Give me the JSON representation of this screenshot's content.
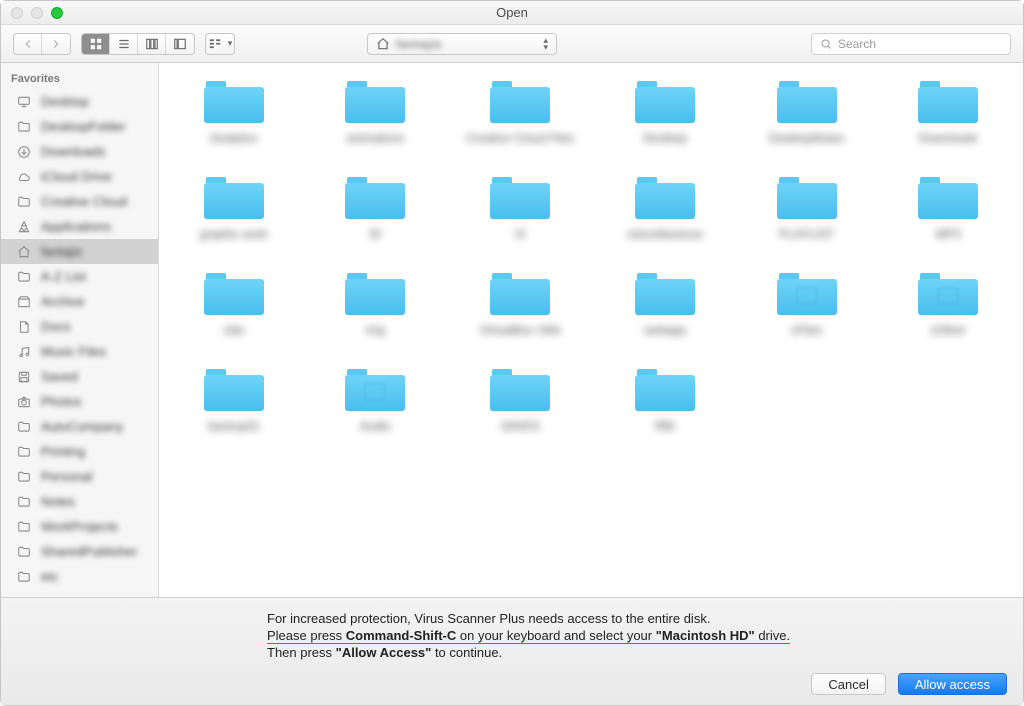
{
  "window": {
    "title": "Open"
  },
  "toolbar": {
    "path_label": "fantajis",
    "search_placeholder": "Search"
  },
  "sidebar": {
    "header": "Favorites",
    "items": [
      {
        "label": "Desktop",
        "icon": "display"
      },
      {
        "label": "DesktopFolder",
        "icon": "folder"
      },
      {
        "label": "Downloads",
        "icon": "download"
      },
      {
        "label": "iCloud Drive",
        "icon": "cloud"
      },
      {
        "label": "Creative Cloud",
        "icon": "folder"
      },
      {
        "label": "Applications",
        "icon": "apps"
      },
      {
        "label": "fantajis",
        "icon": "home",
        "selected": true
      },
      {
        "label": "A-Z List",
        "icon": "folder"
      },
      {
        "label": "Archive",
        "icon": "box"
      },
      {
        "label": "Docs",
        "icon": "doc"
      },
      {
        "label": "Music Files",
        "icon": "music"
      },
      {
        "label": "Saved",
        "icon": "save"
      },
      {
        "label": "Photos",
        "icon": "camera"
      },
      {
        "label": "AutoCompany",
        "icon": "folder"
      },
      {
        "label": "Printing",
        "icon": "folder"
      },
      {
        "label": "Personal",
        "icon": "folder"
      },
      {
        "label": "Notes",
        "icon": "folder"
      },
      {
        "label": "WorkProjects",
        "icon": "folder"
      },
      {
        "label": "SharedPublisher",
        "icon": "folder"
      },
      {
        "label": "etc",
        "icon": "folder"
      }
    ]
  },
  "files": [
    {
      "name": "Analytics"
    },
    {
      "name": "animations"
    },
    {
      "name": "Creative Cloud Files"
    },
    {
      "name": "Desktop"
    },
    {
      "name": "DesktopNotes"
    },
    {
      "name": "Downloads"
    },
    {
      "name": "graphic work"
    },
    {
      "name": "ID"
    },
    {
      "name": "IX"
    },
    {
      "name": "miscellaneous"
    },
    {
      "name": "PLAYLIST"
    },
    {
      "name": "MP3"
    },
    {
      "name": "vids"
    },
    {
      "name": "img"
    },
    {
      "name": "VirtualBox VMs"
    },
    {
      "name": "webapp"
    },
    {
      "name": "xFiles",
      "stamp": true
    },
    {
      "name": "zOther",
      "stamp": true
    },
    {
      "name": "backup01"
    },
    {
      "name": "Audio",
      "stamp": true
    },
    {
      "name": "SAVES"
    },
    {
      "name": "RBI"
    }
  ],
  "message": {
    "line1": "For increased protection, Virus Scanner Plus needs access to the entire disk.",
    "line2_a": "Please press ",
    "line2_b": "Command-Shift-C",
    "line2_c": " on your keyboard and select your ",
    "line2_d": "\"Macintosh HD\"",
    "line2_e": " drive.",
    "line3_a": "Then press ",
    "line3_b": "\"Allow Access\"",
    "line3_c": " to continue."
  },
  "buttons": {
    "cancel": "Cancel",
    "allow": "Allow access"
  }
}
